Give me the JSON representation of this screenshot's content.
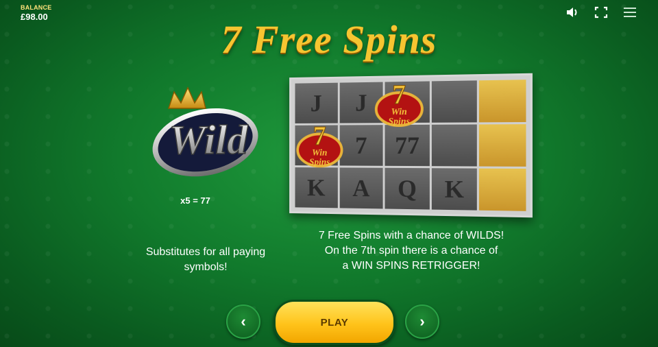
{
  "balance": {
    "label": "BALANCE",
    "value": "£98.00"
  },
  "top_icons": [
    "speaker-icon",
    "fullscreen-icon",
    "menu-icon"
  ],
  "title": "7 Free Spins",
  "wild": {
    "logo_text": "Wild",
    "pay": "x5 = 77",
    "description": "Substitutes for all paying symbols!"
  },
  "reels": {
    "symbols": [
      [
        "J",
        "J",
        "7",
        "",
        ""
      ],
      [
        "",
        "7",
        "77",
        "",
        ""
      ],
      [
        "K",
        "A",
        "Q",
        "K",
        ""
      ]
    ],
    "win_spins_text": [
      "Win",
      "Spins"
    ]
  },
  "free_spins_description": {
    "line1": "7 Free Spins with a chance of WILDS!",
    "line2": "On the 7th spin there is a chance of",
    "line3": "a WIN SPINS RETRIGGER!"
  },
  "controls": {
    "prev": "‹",
    "play": "PLAY",
    "next": "›"
  },
  "colors": {
    "title_gold": "#f6c531",
    "background_green": "#117a2c",
    "play_yellow": "#ffc31a"
  }
}
